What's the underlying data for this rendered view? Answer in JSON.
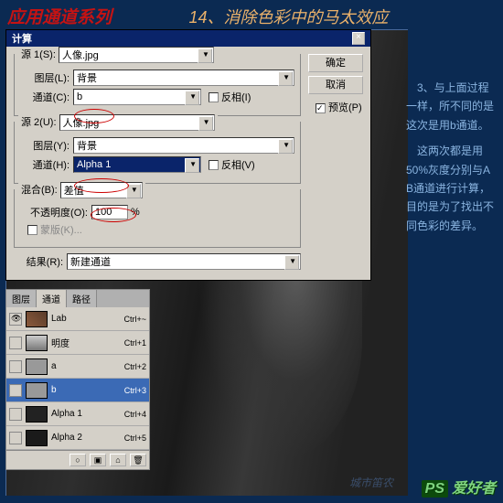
{
  "header": {
    "left": "应用通道系列",
    "right": "14、消除色彩中的马太效应"
  },
  "sidebar": {
    "p1": "3、与上面过程一样，所不同的是这次是用b通道。",
    "p2": "这两次都是用50%灰度分别与A B通道进行计算，目的是为了找出不同色彩的差异。"
  },
  "dialog": {
    "title": "计算",
    "ok": "确定",
    "cancel": "取消",
    "preview": "预览(P)",
    "src1": {
      "legend": "源 1(S):",
      "src_value": "人像.jpg",
      "layer_label": "图层(L):",
      "layer_value": "背景",
      "channel_label": "通道(C):",
      "channel_value": "b",
      "invert": "反相(I)"
    },
    "src2": {
      "legend": "源 2(U):",
      "src_value": "人像.jpg",
      "layer_label": "图层(Y):",
      "layer_value": "背景",
      "channel_label": "通道(H):",
      "channel_value": "Alpha 1",
      "invert": "反相(V)"
    },
    "blend": {
      "label": "混合(B):",
      "value": "差值",
      "opacity_label": "不透明度(O):",
      "opacity_value": "100",
      "opacity_unit": "%",
      "mask": "蒙版(K)..."
    },
    "result": {
      "label": "结果(R):",
      "value": "新建通道"
    }
  },
  "panel": {
    "tabs": [
      "图层",
      "通道",
      "路径"
    ],
    "channels": [
      {
        "name": "Lab",
        "key": "Ctrl+~",
        "eye": true,
        "thumb": "t1"
      },
      {
        "name": "明度",
        "key": "Ctrl+1",
        "eye": false,
        "thumb": "t2"
      },
      {
        "name": "a",
        "key": "Ctrl+2",
        "eye": false,
        "thumb": "t3"
      },
      {
        "name": "b",
        "key": "Ctrl+3",
        "eye": false,
        "thumb": "t3",
        "selected": true
      },
      {
        "name": "Alpha 1",
        "key": "Ctrl+4",
        "eye": false,
        "thumb": "t4"
      },
      {
        "name": "Alpha 2",
        "key": "Ctrl+5",
        "eye": false,
        "thumb": "t5"
      }
    ],
    "foot": [
      "○",
      "▣",
      "⌂",
      "🗑"
    ]
  },
  "watermark": {
    "ps": "PS",
    "text": "爱好者",
    "sub": "城市笛农"
  }
}
